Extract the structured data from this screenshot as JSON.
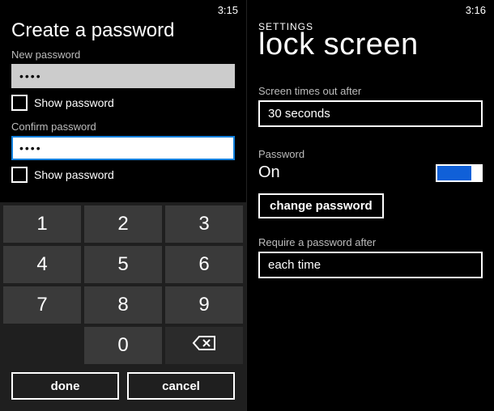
{
  "left": {
    "time": "3:15",
    "title": "Create a password",
    "new_password_label": "New password",
    "new_password_value": "••••",
    "show_password1_label": "Show password",
    "confirm_password_label": "Confirm password",
    "confirm_password_value": "••••",
    "show_password2_label": "Show password",
    "keys": [
      "1",
      "2",
      "3",
      "4",
      "5",
      "6",
      "7",
      "8",
      "9",
      "",
      "0"
    ],
    "done_label": "done",
    "cancel_label": "cancel"
  },
  "right": {
    "time": "3:16",
    "header": "SETTINGS",
    "title": "lock screen",
    "timeout_label": "Screen times out after",
    "timeout_value": "30 seconds",
    "password_label": "Password",
    "password_state": "On",
    "change_password_label": "change password",
    "require_label": "Require a password after",
    "require_value": "each time"
  }
}
